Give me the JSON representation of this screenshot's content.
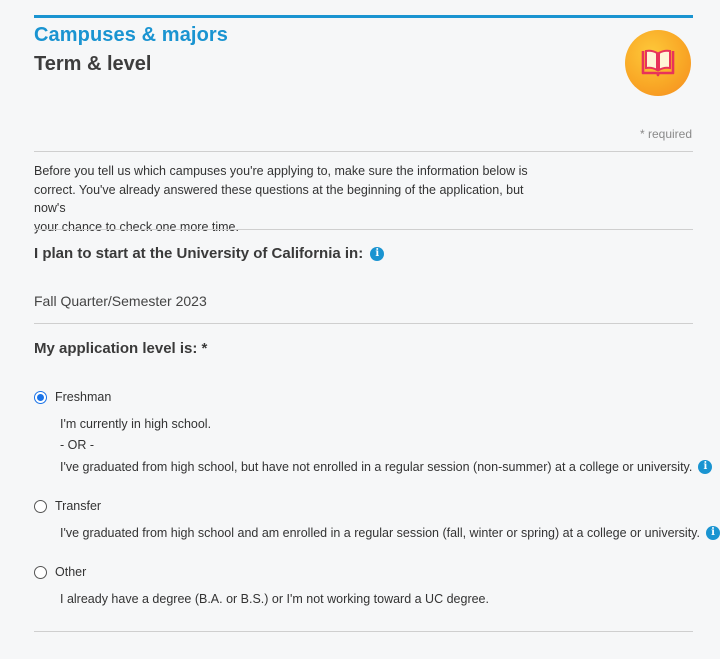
{
  "header": {
    "section_title": "Campuses & majors",
    "page_title": "Term & level",
    "required_note": "* required"
  },
  "intro": {
    "line1": "Before you tell us which campuses you're applying to, make sure the information below is",
    "line2": "correct. You've already answered these questions at the beginning of the application, but now's",
    "line3": "your chance to check one more time."
  },
  "term": {
    "question": "I plan to start at the University of California in:",
    "value": "Fall Quarter/Semester 2023"
  },
  "level": {
    "question": "My application level is: *",
    "options": [
      {
        "label": "Freshman",
        "checked": true,
        "desc1": "I'm currently in high school.",
        "desc2": "- OR -",
        "desc3": "I've graduated from high school, but have not enrolled in a regular session (non-summer) at a college or university."
      },
      {
        "label": "Transfer",
        "checked": false,
        "desc1": "I've graduated from high school and am enrolled in a regular session (fall, winter or spring) at a college or university."
      },
      {
        "label": "Other",
        "checked": false,
        "desc1": "I already have a degree (B.A. or B.S.) or I'm not working toward a UC degree."
      }
    ]
  },
  "icons": {
    "info": "info-icon",
    "logo": "book-icon"
  },
  "colors": {
    "accent": "#1a94d1",
    "radio_selected": "#1a73e8",
    "logo_orange": "#f9a826",
    "logo_book": "#e8325a"
  }
}
